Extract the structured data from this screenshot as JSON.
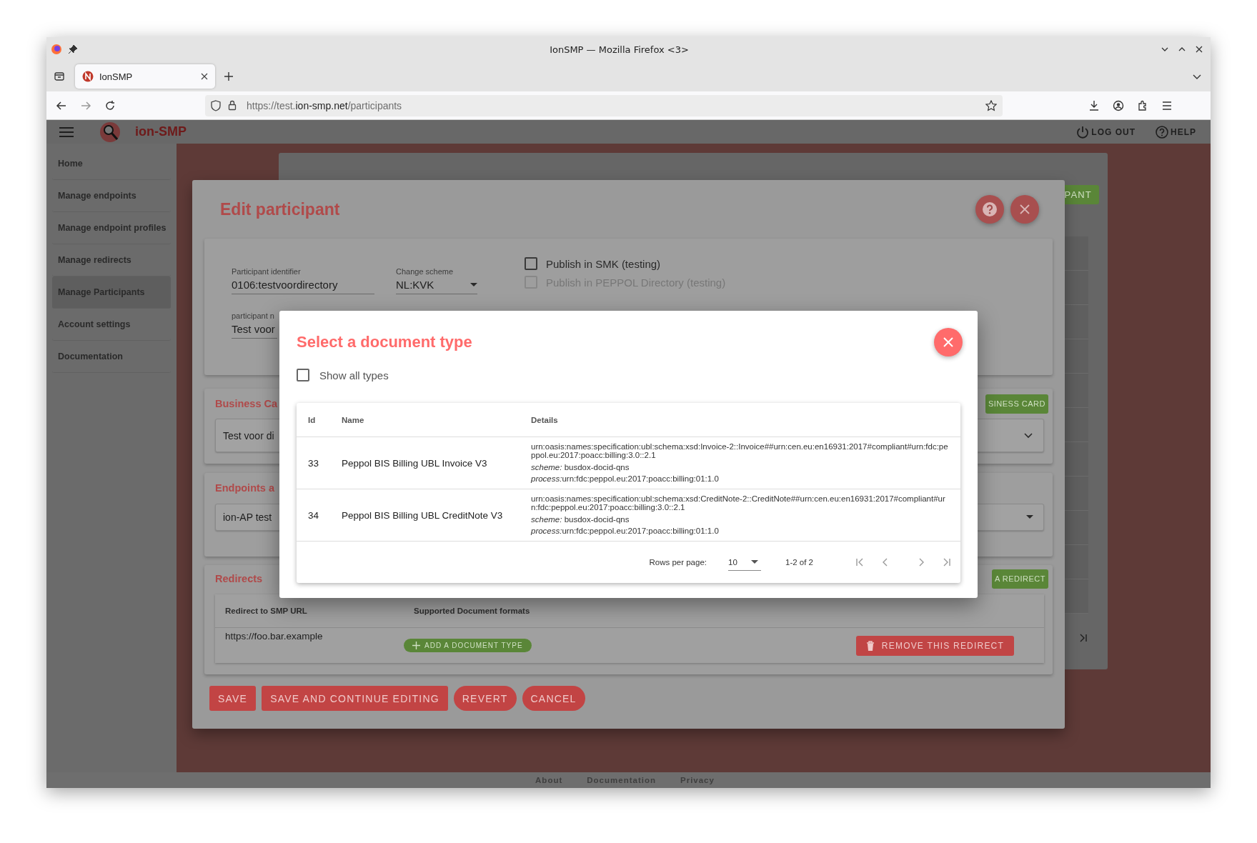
{
  "browser": {
    "window_title": "IonSMP — Mozilla Firefox <3>",
    "tabs": [
      {
        "title": "IonSMP",
        "selected": true
      }
    ],
    "url": {
      "scheme": "https://test.",
      "host": "ion-smp.net",
      "path": "/participants"
    }
  },
  "header": {
    "app_name": "ion-SMP",
    "actions": [
      {
        "kind": "logout",
        "label": "LOG OUT"
      },
      {
        "kind": "help",
        "label": "HELP"
      }
    ]
  },
  "sidebar": {
    "items": [
      {
        "label": "Home",
        "selected": false
      },
      {
        "label": "Manage endpoints",
        "selected": false
      },
      {
        "label": "Manage endpoint profiles",
        "selected": false
      },
      {
        "label": "Manage redirects",
        "selected": false
      },
      {
        "label": "Manage Participants",
        "selected": true
      },
      {
        "label": "Account settings",
        "selected": false
      },
      {
        "label": "Documentation",
        "selected": false
      }
    ]
  },
  "background_page": {
    "button": "PANT"
  },
  "edit_dialog": {
    "title": "Edit participant",
    "identifier": {
      "label": "Participant identifier",
      "value": "0106:testvoordirectory"
    },
    "scheme": {
      "label": "Change scheme",
      "value": "NL:KVK"
    },
    "options": [
      {
        "label": "Publish in SMK (testing)",
        "checked": false,
        "disabled": false
      },
      {
        "label": "Publish in PEPPOL Directory (testing)",
        "checked": false,
        "disabled": true
      }
    ],
    "name_field": {
      "label": "participant n",
      "value": "Test voor"
    },
    "business_card": {
      "title": "Business Ca",
      "button": "SINESS CARD",
      "value": "Test voor di"
    },
    "endpoints": {
      "title": "Endpoints a",
      "value": "ion-AP test"
    },
    "redirects": {
      "title": "Redirects",
      "button": "A REDIRECT",
      "columns": [
        "Redirect to SMP URL",
        "Supported Document formats"
      ],
      "rows": [
        {
          "url": "https://foo.bar.example",
          "add_label": "ADD A DOCUMENT TYPE",
          "remove_label": "REMOVE THIS REDIRECT"
        }
      ]
    },
    "actions": [
      {
        "label": "SAVE",
        "kind": "rect"
      },
      {
        "label": "SAVE AND CONTINUE EDITING",
        "kind": "rect"
      },
      {
        "label": "REVERT",
        "kind": "pill"
      },
      {
        "label": "CANCEL",
        "kind": "pill"
      }
    ]
  },
  "document_dialog": {
    "title": "Select a document type",
    "show_all": {
      "label": "Show all types",
      "checked": false
    },
    "columns": [
      "Id",
      "Name",
      "Details"
    ],
    "rows": [
      {
        "id": "33",
        "name": "Peppol BIS Billing UBL Invoice V3",
        "urn": "urn:oasis:names:specification:ubl:schema:xsd:Invoice-2::Invoice##urn:cen.eu:en16931:2017#compliant#urn:fdc:peppol.eu:2017:poacc:billing:3.0::2.1",
        "scheme_label": "scheme:",
        "scheme": "busdox-docid-qns",
        "process_label": "process:",
        "process": "urn:fdc:peppol.eu:2017:poacc:billing:01:1.0"
      },
      {
        "id": "34",
        "name": "Peppol BIS Billing UBL CreditNote V3",
        "urn": "urn:oasis:names:specification:ubl:schema:xsd:CreditNote-2::CreditNote##urn:cen.eu:en16931:2017#compliant#urn:fdc:peppol.eu:2017:poacc:billing:3.0::2.1",
        "scheme_label": "scheme:",
        "scheme": "busdox-docid-qns",
        "process_label": "process:",
        "process": "urn:fdc:peppol.eu:2017:poacc:billing:01:1.0"
      }
    ],
    "pagination": {
      "rows_label": "Rows per page:",
      "rows_value": "10",
      "range": "1-2 of 2"
    }
  },
  "footer": {
    "links": [
      "About",
      "Documentation",
      "Privacy"
    ]
  }
}
